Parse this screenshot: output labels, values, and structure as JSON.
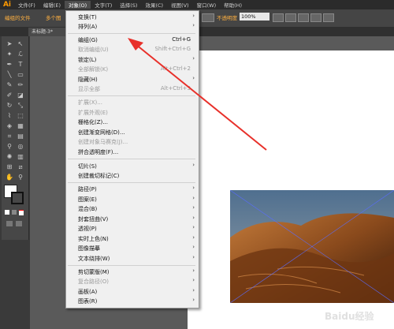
{
  "app": {
    "logo": "Ai"
  },
  "menubar": {
    "items": [
      "文件(F)",
      "编辑(E)",
      "对象(O)",
      "文字(T)",
      "选择(S)",
      "效果(C)",
      "视图(V)",
      "窗口(W)",
      "帮助(H)"
    ]
  },
  "control_bar": {
    "left_label": "编组的文件",
    "second_label": "多个图",
    "right_label": "不透明度",
    "zoom_value": "100%"
  },
  "document_tab": {
    "title": "未标题-3*"
  },
  "object_menu": {
    "items": [
      {
        "label": "变换(T)",
        "submenu": true
      },
      {
        "label": "排列(A)",
        "submenu": true
      },
      {
        "label": "编组(G)",
        "shortcut": "Ctrl+G",
        "disabled": false
      },
      {
        "label": "取消编组(U)",
        "shortcut": "Shift+Ctrl+G",
        "disabled": true
      },
      {
        "label": "锁定(L)",
        "submenu": true
      },
      {
        "label": "全部解锁(K)",
        "shortcut": "Alt+Ctrl+2",
        "disabled": true
      },
      {
        "label": "隐藏(H)",
        "submenu": true
      },
      {
        "label": "显示全部",
        "shortcut": "Alt+Ctrl+3",
        "disabled": true
      },
      {
        "label": "扩展(X)...",
        "disabled": true
      },
      {
        "label": "扩展外观(E)",
        "disabled": true
      },
      {
        "label": "栅格化(Z)..."
      },
      {
        "label": "创建渐变网格(D)..."
      },
      {
        "label": "创建对象马赛克(J)...",
        "disabled": true
      },
      {
        "label": "拼合透明度(F)..."
      },
      {
        "label": "切片(S)",
        "submenu": true
      },
      {
        "label": "创建裁切标记(C)"
      },
      {
        "label": "路径(P)",
        "submenu": true
      },
      {
        "label": "图案(E)",
        "submenu": true
      },
      {
        "label": "混合(B)",
        "submenu": true
      },
      {
        "label": "封套扭曲(V)",
        "submenu": true
      },
      {
        "label": "透视(P)",
        "submenu": true
      },
      {
        "label": "实时上色(N)",
        "submenu": true
      },
      {
        "label": "图像描摹",
        "submenu": true
      },
      {
        "label": "文本绕排(W)",
        "submenu": true
      },
      {
        "label": "剪切蒙版(M)",
        "submenu": true
      },
      {
        "label": "复合路径(O)",
        "submenu": true,
        "disabled": true
      },
      {
        "label": "画板(A)",
        "submenu": true
      },
      {
        "label": "图表(R)",
        "submenu": true
      }
    ]
  },
  "watermark": {
    "text": "Baidu经验"
  },
  "colors": {
    "annotation_arrow": "#e8302a",
    "accent": "#ff9a00"
  }
}
